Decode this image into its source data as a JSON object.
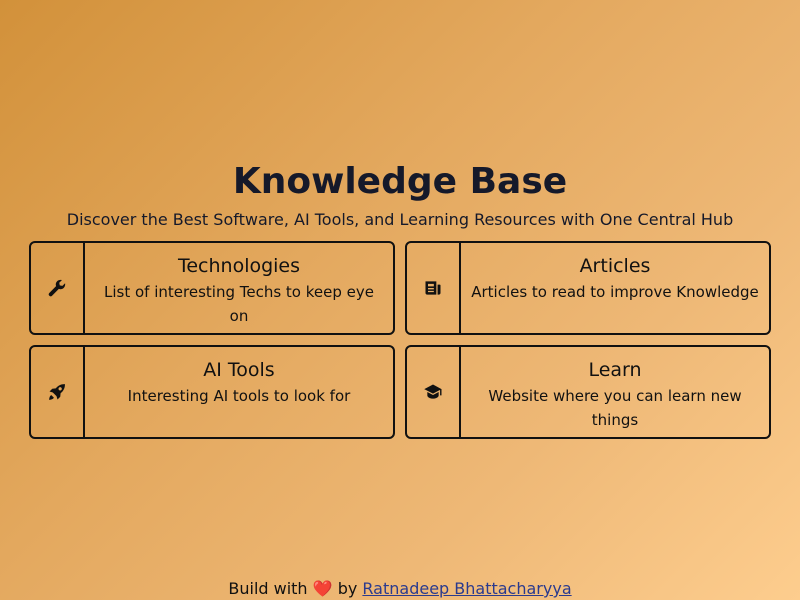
{
  "header": {
    "title": "Knowledge Base",
    "subtitle": "Discover the Best Software, AI Tools, and Learning Resources with One Central Hub"
  },
  "cards": [
    {
      "title": "Technologies",
      "description": "List of interesting Techs to keep eye on",
      "icon": "wrench-icon"
    },
    {
      "title": "Articles",
      "description": "Articles to read to improve Knowledge",
      "icon": "newspaper-icon"
    },
    {
      "title": "AI Tools",
      "description": "Interesting AI tools to look for",
      "icon": "rocket-icon"
    },
    {
      "title": "Learn",
      "description": "Website where you can learn new things",
      "icon": "graduation-cap-icon"
    }
  ],
  "footer": {
    "prefix": "Build with",
    "heart": "❤️",
    "by": "by",
    "author": "Ratnadeep Bhattacharyya"
  },
  "colors": {
    "text": "#15192a",
    "border": "#111111",
    "link": "#2a3a8e",
    "background_start": "#d2913a",
    "background_end": "#fdcd8e"
  }
}
